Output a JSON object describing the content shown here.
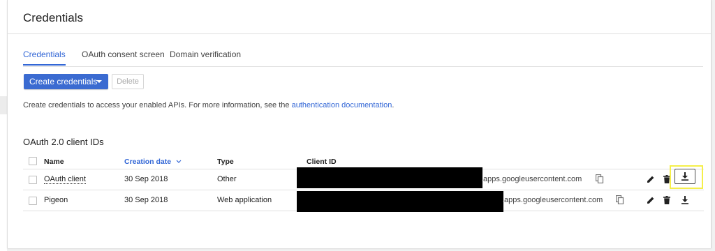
{
  "page": {
    "title": "Credentials"
  },
  "tabs": [
    {
      "label": "Credentials",
      "active": true
    },
    {
      "label": "OAuth consent screen",
      "active": false
    },
    {
      "label": "Domain verification",
      "active": false
    }
  ],
  "toolbar": {
    "create_label": "Create credentials",
    "delete_label": "Delete"
  },
  "description": {
    "text": "Create credentials to access your enabled APIs. For more information, see the ",
    "link": "authentication documentation",
    "suffix": "."
  },
  "section": {
    "title": "OAuth 2.0 client IDs"
  },
  "table": {
    "columns": {
      "name": "Name",
      "creation_date": "Creation date",
      "type": "Type",
      "client_id": "Client ID"
    },
    "rows": [
      {
        "name": "OAuth client",
        "date": "30 Sep 2018",
        "type": "Other",
        "client_id_suffix": ".apps.googleusercontent.com"
      },
      {
        "name": "Pigeon",
        "date": "30 Sep 2018",
        "type": "Web application",
        "client_id_suffix": ".apps.googleusercontent.com"
      }
    ]
  },
  "colors": {
    "accent": "#3367d6",
    "primary_button": "#3b6bd1",
    "highlight": "#f5ef4a"
  }
}
